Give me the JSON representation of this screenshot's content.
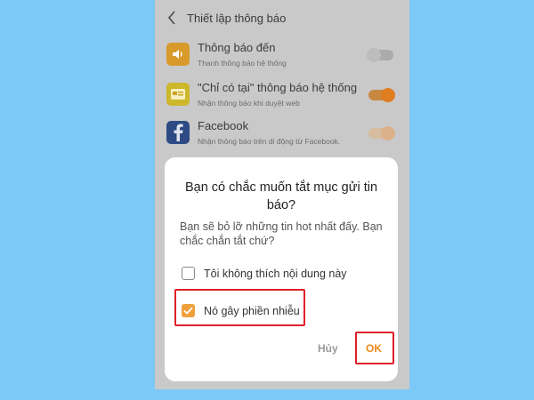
{
  "header": {
    "title": "Thiết lập thông báo",
    "back_icon": "chevron-left-icon"
  },
  "settings": [
    {
      "title": "Thông báo đến",
      "subtitle": "Thanh thông báo hệ thống",
      "icon": "speaker-icon",
      "icon_color": "#e8a21a",
      "enabled": false
    },
    {
      "title": "\"Chỉ có tại\" thông báo hệ thống",
      "subtitle": "Nhận thông báo khi duyệt web",
      "icon": "card-icon",
      "icon_color": "#d9c21c",
      "enabled": true
    },
    {
      "title": "Facebook",
      "subtitle": "Nhận thông báo trên di động từ Facebook.",
      "icon": "facebook-icon",
      "icon_color": "#2d4a85",
      "enabled": true
    }
  ],
  "dialog": {
    "title": "Bạn có chắc muốn tắt mục gửi tin báo?",
    "message": "Bạn sẽ bỏ lỡ những tin hot nhất đấy. Bạn chắc chắn tắt chứ?",
    "options": [
      {
        "label": "Tôi không thích nội dung này",
        "checked": false
      },
      {
        "label": "Nó gây phiền nhiễu",
        "checked": true
      }
    ],
    "cancel_label": "Hủy",
    "ok_label": "OK"
  },
  "colors": {
    "page_background": "#7cc9f7",
    "accent": "#f0a03c",
    "highlight": "#e0202a"
  }
}
